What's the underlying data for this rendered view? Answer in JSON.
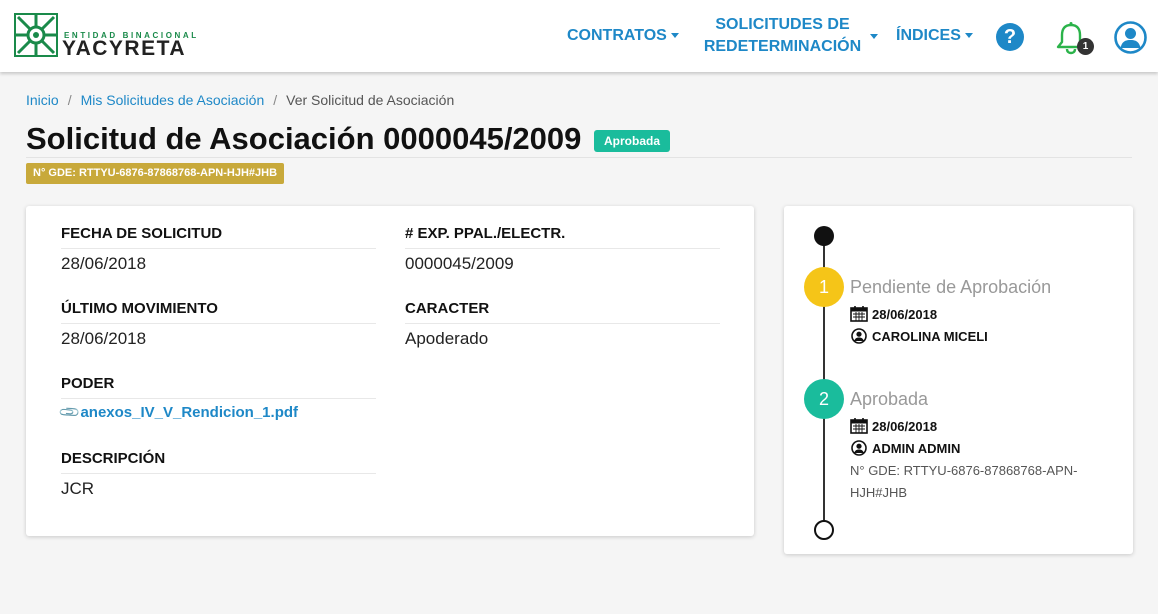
{
  "brand": {
    "subtitle": "ENTIDAD BINACIONAL",
    "name": "YACYRETA",
    "color": "#1a8a4a"
  },
  "nav": {
    "contratos": "CONTRATOS",
    "solicitudes_line1": "SOLICITUDES DE",
    "solicitudes_line2": "REDETERMINACIÓN",
    "indices": "ÍNDICES",
    "help": "?",
    "notifications_count": "1",
    "accent": "#1e88c7"
  },
  "breadcrumb": {
    "home": "Inicio",
    "parent": "Mis Solicitudes de Asociación",
    "current": "Ver Solicitud de Asociación",
    "sep": "/"
  },
  "page": {
    "title": "Solicitud de Asociación 0000045/2009",
    "status": "Aprobada",
    "gde": "N° GDE: RTTYU-6876-87868768-APN-HJH#JHB"
  },
  "details": {
    "fecha_label": "FECHA DE SOLICITUD",
    "fecha_value": "28/06/2018",
    "exp_label": "# EXP. PPAL./ELECTR.",
    "exp_value": "0000045/2009",
    "ultimo_label": "ÚLTIMO MOVIMIENTO",
    "ultimo_value": "28/06/2018",
    "caracter_label": "CARACTER",
    "caracter_value": "Apoderado",
    "poder_label": "PODER",
    "poder_file": "anexos_IV_V_Rendicion_1.pdf",
    "descripcion_label": "DESCRIPCIÓN",
    "descripcion_value": "JCR"
  },
  "timeline": {
    "steps": [
      {
        "number": "1",
        "title": "Pendiente de Aprobación",
        "date": "28/06/2018",
        "user": "CAROLINA MICELI",
        "color": "#f5c518"
      },
      {
        "number": "2",
        "title": "Aprobada",
        "date": "28/06/2018",
        "user": "ADMIN ADMIN",
        "color": "#1abc9c",
        "note": "N° GDE: RTTYU-6876-87868768-APN-HJH#JHB"
      }
    ]
  }
}
